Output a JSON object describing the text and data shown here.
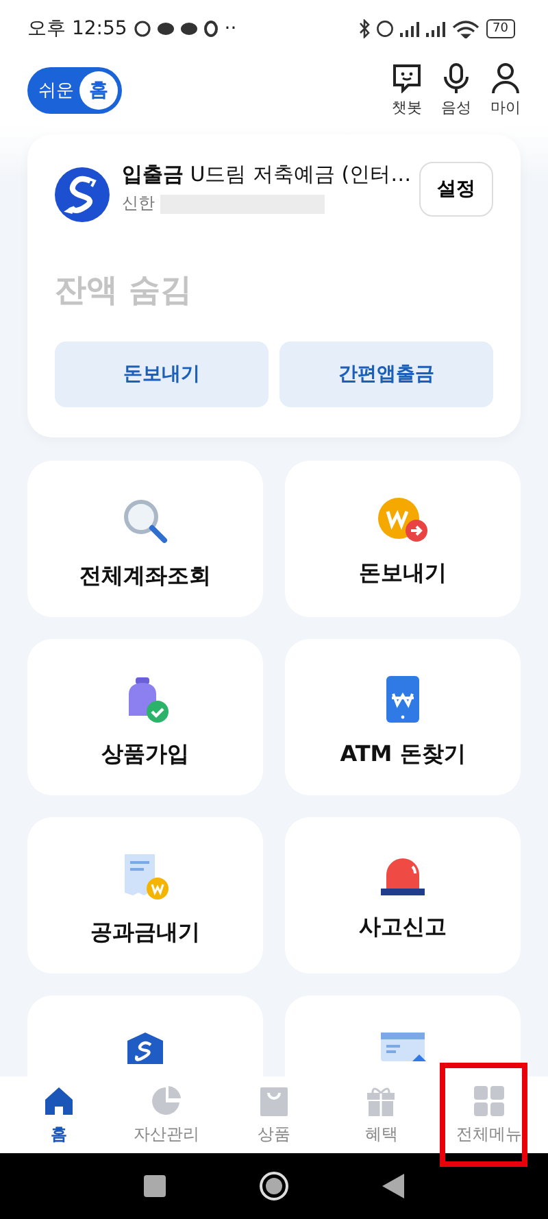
{
  "status_bar": {
    "time": "오후 12:55",
    "more": "··",
    "battery": "70"
  },
  "header": {
    "mode_toggle": {
      "off_label": "쉬운",
      "on_label": "홈",
      "on": true
    },
    "actions": [
      {
        "kind": "chatbot",
        "label": "챗봇"
      },
      {
        "kind": "voice",
        "label": "음성"
      },
      {
        "kind": "profile",
        "label": "마이"
      }
    ]
  },
  "account": {
    "title": "**입출금** U드림 저축예금 (인터…",
    "bank": "신한",
    "number_hidden": true,
    "settings_button": "설정",
    "balance": "잔액 숨김",
    "buttons": [
      "돈보내기",
      "간편앱출금"
    ]
  },
  "tiles": [
    {
      "kind": "search",
      "label": "전체계좌조회"
    },
    {
      "kind": "send",
      "label": "돈보내기"
    },
    {
      "kind": "product",
      "label": "상품가입"
    },
    {
      "kind": "atm",
      "label": "ATM 돈찾기"
    },
    {
      "kind": "bill",
      "label": "공과금내기"
    },
    {
      "kind": "siren",
      "label": "사고신고"
    },
    {
      "kind": "shield"
    },
    {
      "kind": "card"
    }
  ],
  "bottom_nav": [
    {
      "kind": "home",
      "label": "홈",
      "selected": true,
      "highlighted": false
    },
    {
      "kind": "assets",
      "label": "자산관리",
      "selected": false,
      "highlighted": false
    },
    {
      "kind": "shop",
      "label": "상품",
      "selected": false,
      "highlighted": false
    },
    {
      "kind": "gift",
      "label": "혜택",
      "selected": false,
      "highlighted": false
    },
    {
      "kind": "menu",
      "label": "전체메뉴",
      "selected": false,
      "highlighted": true
    }
  ]
}
